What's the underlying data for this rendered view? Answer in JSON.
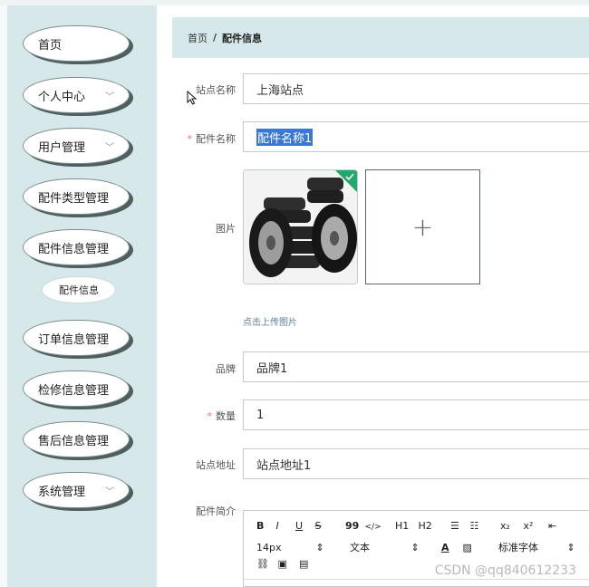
{
  "sidebar": {
    "items": [
      {
        "label": "首页",
        "has_chevron": false
      },
      {
        "label": "个人中心",
        "has_chevron": true
      },
      {
        "label": "用户管理",
        "has_chevron": true
      },
      {
        "label": "配件类型管理",
        "has_chevron": true
      },
      {
        "label": "配件信息管理",
        "has_chevron": true
      },
      {
        "label": "订单信息管理",
        "has_chevron": true
      },
      {
        "label": "检修信息管理",
        "has_chevron": true
      },
      {
        "label": "售后信息管理",
        "has_chevron": true
      },
      {
        "label": "系统管理",
        "has_chevron": true
      }
    ],
    "sub_item": "配件信息",
    "chevron_glyph": "﹀"
  },
  "breadcrumb": {
    "home": "首页",
    "separator": "/",
    "current": "配件信息"
  },
  "form": {
    "station_name": {
      "label": "站点名称",
      "value": "上海站点"
    },
    "part_name": {
      "label": "配件名称",
      "value": "配件名称1",
      "required": true
    },
    "image": {
      "label": "图片",
      "upload_tip": "点击上传图片",
      "add_symbol": "+"
    },
    "brand": {
      "label": "品牌",
      "value": "品牌1"
    },
    "quantity": {
      "label": "数量",
      "value": "1",
      "required": true
    },
    "station_address": {
      "label": "站点地址",
      "value": "站点地址1"
    },
    "intro": {
      "label": "配件简介"
    },
    "required_mark": "*"
  },
  "editor": {
    "toolbar_row1": [
      "B",
      "I",
      "U",
      "S",
      "99",
      "</>",
      "H1",
      "H2",
      "☰",
      "☷",
      "x₂",
      "x²",
      "⇤"
    ],
    "font_size": "14px",
    "text_type": "文本",
    "font_family": "标准字体",
    "spin_glyph": "⇕"
  },
  "watermark": "CSDN @qq840612233",
  "colors": {
    "sidebar_bg": "#d7e8ea",
    "selection": "#3a78d6",
    "required": "#f56c6c",
    "uploaded_badge": "#22a86a"
  }
}
